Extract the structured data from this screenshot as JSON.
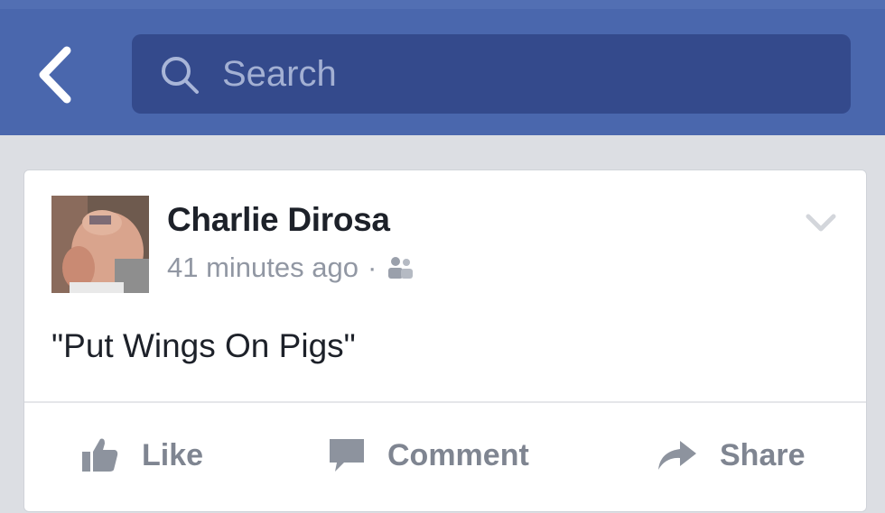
{
  "header": {
    "back_icon": "chevron-left-icon",
    "search": {
      "placeholder": "Search",
      "icon": "search-icon"
    }
  },
  "post": {
    "author": "Charlie Dirosa",
    "timestamp": "41 minutes ago",
    "separator": "·",
    "audience_icon": "friends-icon",
    "options_icon": "chevron-down-icon",
    "text": "\"Put Wings On Pigs\"",
    "actions": {
      "like": "Like",
      "comment": "Comment",
      "share": "Share"
    }
  },
  "colors": {
    "header_bg": "#4a67ad",
    "search_bg": "#344a8c",
    "page_bg": "#dcdee3",
    "action_text": "#7f8591"
  }
}
